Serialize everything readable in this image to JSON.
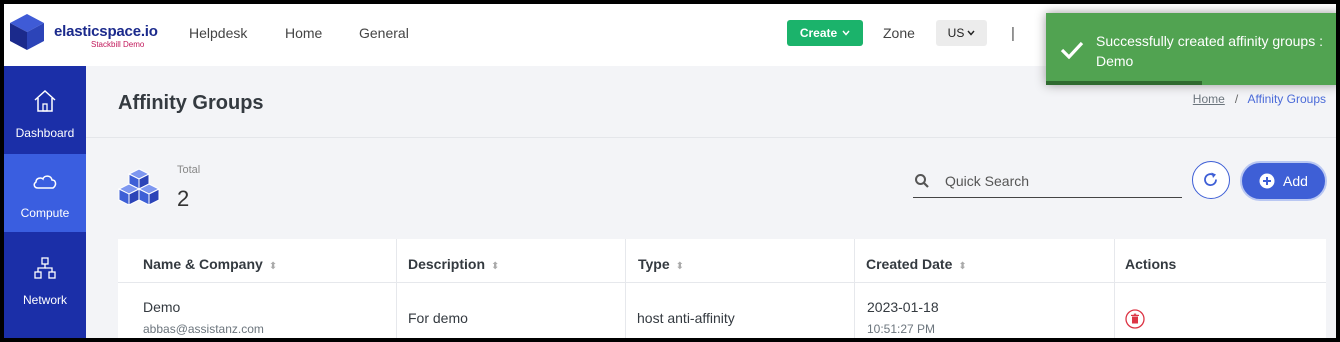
{
  "header": {
    "logo_name": "elasticspace.io",
    "logo_sub": "Stackbill Demo",
    "nav": [
      "Helpdesk",
      "Home",
      "General"
    ],
    "create_label": "Create",
    "zone_label": "Zone",
    "zone_value": "US",
    "separator": "|"
  },
  "sidebar": {
    "items": [
      {
        "label": "Dashboard",
        "icon": "home-icon"
      },
      {
        "label": "Compute",
        "icon": "cloud-icon"
      },
      {
        "label": "Network",
        "icon": "network-icon"
      }
    ]
  },
  "page": {
    "title": "Affinity Groups",
    "breadcrumb_home": "Home",
    "breadcrumb_sep": "/",
    "breadcrumb_current": "Affinity Groups"
  },
  "stats": {
    "total_label": "Total",
    "total_value": "2"
  },
  "search": {
    "placeholder": "Quick Search"
  },
  "actions": {
    "add_label": "Add"
  },
  "table": {
    "headers": [
      "Name & Company",
      "Description",
      "Type",
      "Created Date",
      "Actions"
    ],
    "rows": [
      {
        "name": "Demo",
        "email": "abbas@assistanz.com",
        "description": "For demo",
        "type": "host anti-affinity",
        "date": "2023-01-18",
        "time": "10:51:27 PM"
      }
    ]
  },
  "toast": {
    "message": "Successfully created affinity groups : Demo",
    "progress": 0.53
  },
  "colors": {
    "sidebar": "#1b2fa8",
    "sidebar_active": "#3a5ee0",
    "create": "#1bb36b",
    "primary": "#3e5fd6",
    "toast": "#51a351",
    "danger": "#dc3545"
  }
}
